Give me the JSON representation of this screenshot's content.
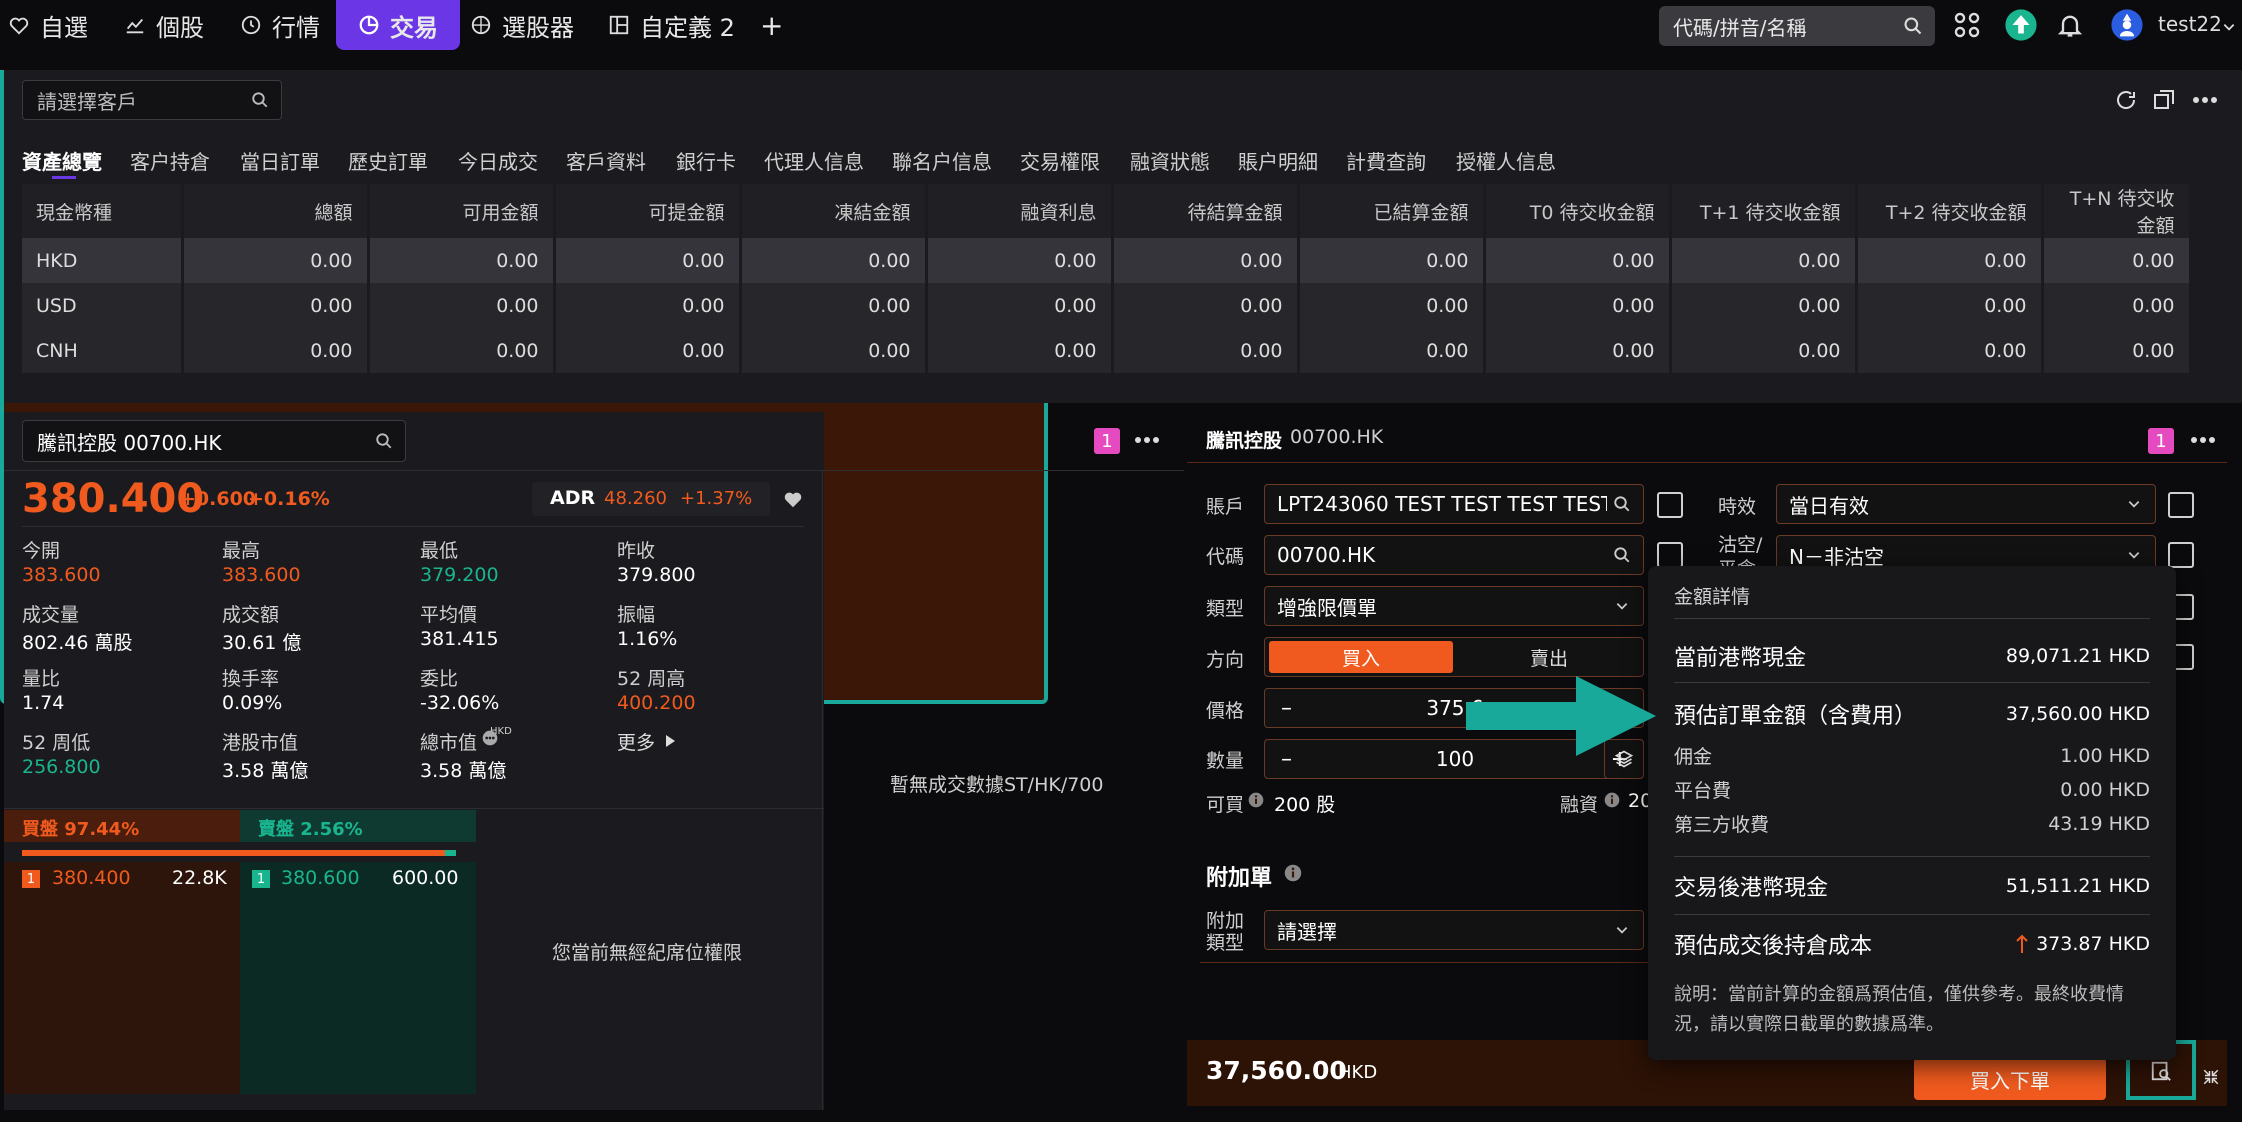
{
  "nav": {
    "items": [
      {
        "label": "自選",
        "icon": "heart-icon"
      },
      {
        "label": "個股",
        "icon": "chart-line-icon"
      },
      {
        "label": "行情",
        "icon": "clock-icon"
      },
      {
        "label": "交易",
        "icon": "pie-icon"
      },
      {
        "label": "選股器",
        "icon": "target-icon"
      },
      {
        "label": "自定義 2",
        "icon": "layout-icon"
      }
    ],
    "add_label": "+",
    "search_placeholder": "代碼/拼音/名稱",
    "username": "test22"
  },
  "assets": {
    "client_placeholder": "請選擇客戶",
    "tabs": [
      "資產總覽",
      "客户持倉",
      "當日訂單",
      "歷史訂單",
      "今日成交",
      "客戶資料",
      "銀行卡",
      "代理人信息",
      "聯名户信息",
      "交易權限",
      "融資狀態",
      "賬户明細",
      "計費查詢",
      "授權人信息"
    ],
    "columns": [
      "現金幣種",
      "總額",
      "可用金額",
      "可提金額",
      "凍結金額",
      "融資利息",
      "待結算金額",
      "已結算金額",
      "T0 待交收金額",
      "T+1 待交收金額",
      "T+2 待交收金額",
      "T+N 待交收金額"
    ],
    "rows": [
      [
        "HKD",
        "0.00",
        "0.00",
        "0.00",
        "0.00",
        "0.00",
        "0.00",
        "0.00",
        "0.00",
        "0.00",
        "0.00",
        "0.00"
      ],
      [
        "USD",
        "0.00",
        "0.00",
        "0.00",
        "0.00",
        "0.00",
        "0.00",
        "0.00",
        "0.00",
        "0.00",
        "0.00",
        "0.00"
      ],
      [
        "CNH",
        "0.00",
        "0.00",
        "0.00",
        "0.00",
        "0.00",
        "0.00",
        "0.00",
        "0.00",
        "0.00",
        "0.00",
        "0.00"
      ]
    ]
  },
  "stock": {
    "search_value": "騰訊控股 00700.HK",
    "badge": "1",
    "price": "380.400",
    "change": "+0.600",
    "change_pct": "+0.16%",
    "adr_label": "ADR",
    "adr_price": "48.260",
    "adr_pct": "+1.37%",
    "stats": [
      {
        "label": "今開",
        "value": "383.600",
        "color": "red"
      },
      {
        "label": "最高",
        "value": "383.600",
        "color": "red"
      },
      {
        "label": "最低",
        "value": "379.200",
        "color": "green"
      },
      {
        "label": "昨收",
        "value": "379.800",
        "color": "white"
      },
      {
        "label": "成交量",
        "value": "802.46 萬股",
        "color": "white"
      },
      {
        "label": "成交額",
        "value": "30.61 億",
        "color": "white"
      },
      {
        "label": "平均價",
        "value": "381.415",
        "color": "white"
      },
      {
        "label": "振幅",
        "value": "1.16%",
        "color": "white"
      },
      {
        "label": "量比",
        "value": "1.74",
        "color": "white"
      },
      {
        "label": "換手率",
        "value": "0.09%",
        "color": "white"
      },
      {
        "label": "委比",
        "value": "-32.06%",
        "color": "white"
      },
      {
        "label": "52 周高",
        "value": "400.200",
        "color": "red"
      },
      {
        "label": "52 周低",
        "value": "256.800",
        "color": "green"
      },
      {
        "label": "港股市值",
        "value": "3.58 萬億",
        "color": "white"
      },
      {
        "label": "總市值",
        "value": "3.58 萬億",
        "color": "white"
      }
    ],
    "total_mcap_currency": "HKD",
    "more_label": "更多",
    "bid_label": "買盤 97.44%",
    "ask_label": "賣盤 2.56%",
    "bid_fraction": 0.9744,
    "bid_level": "1",
    "bid_price": "380.400",
    "bid_vol": "22.8K",
    "ask_level": "1",
    "ask_price": "380.600",
    "ask_vol": "600.00",
    "no_broker": "您當前無經紀席位權限",
    "no_trades": "暫無成交數據ST/HK/700"
  },
  "order": {
    "title": "騰訊控股",
    "code": "00700.HK",
    "badge": "1",
    "account_label": "賬戶",
    "account_value": "LPT243060 TEST TEST TEST TEST",
    "code_label": "代碼",
    "code_value": "00700.HK",
    "type_label": "類型",
    "type_value": "增強限價單",
    "direction_label": "方向",
    "buy_label": "買入",
    "sell_label": "賣出",
    "price_label": "價格",
    "price_value": "375.6",
    "qty_label": "數量",
    "qty_value": "100",
    "buyable_label": "可買",
    "buyable_value": "200 股",
    "margin_label": "融資",
    "margin_value": "20",
    "validity_label": "時效",
    "validity_value": "當日有效",
    "short_label_1": "沽空/",
    "short_label_2": "平倉",
    "short_value": "N－非沽空",
    "addon_title": "附加單",
    "addon_type_label_1": "附加",
    "addon_type_label_2": "類型",
    "addon_type_value": "請選擇",
    "total_amount": "37,560.00",
    "total_currency": "HKD",
    "submit_label": "買入下單"
  },
  "popup": {
    "title": "金額詳情",
    "current_cash_label": "當前港幣現金",
    "current_cash_value": "89,071.21 HKD",
    "est_amount_label": "預估訂單金額（含費用）",
    "est_amount_value": "37,560.00 HKD",
    "commission_label": "佣金",
    "commission_value": "1.00 HKD",
    "platform_label": "平台費",
    "platform_value": "0.00 HKD",
    "third_label": "第三方收費",
    "third_value": "43.19 HKD",
    "after_cash_label": "交易後港幣現金",
    "after_cash_value": "51,511.21 HKD",
    "est_cost_label": "預估成交後持倉成本",
    "est_cost_value": "373.87 HKD",
    "note": "說明：當前計算的金額爲預估值，僅供參考。最終收費情況，請以實際日截單的數據爲準。"
  },
  "colors": {
    "accent": "#6a36e6",
    "up": "#f05a1e",
    "down": "#19b58f",
    "highlight": "#18a99a",
    "order_bg": "#3b1708"
  }
}
